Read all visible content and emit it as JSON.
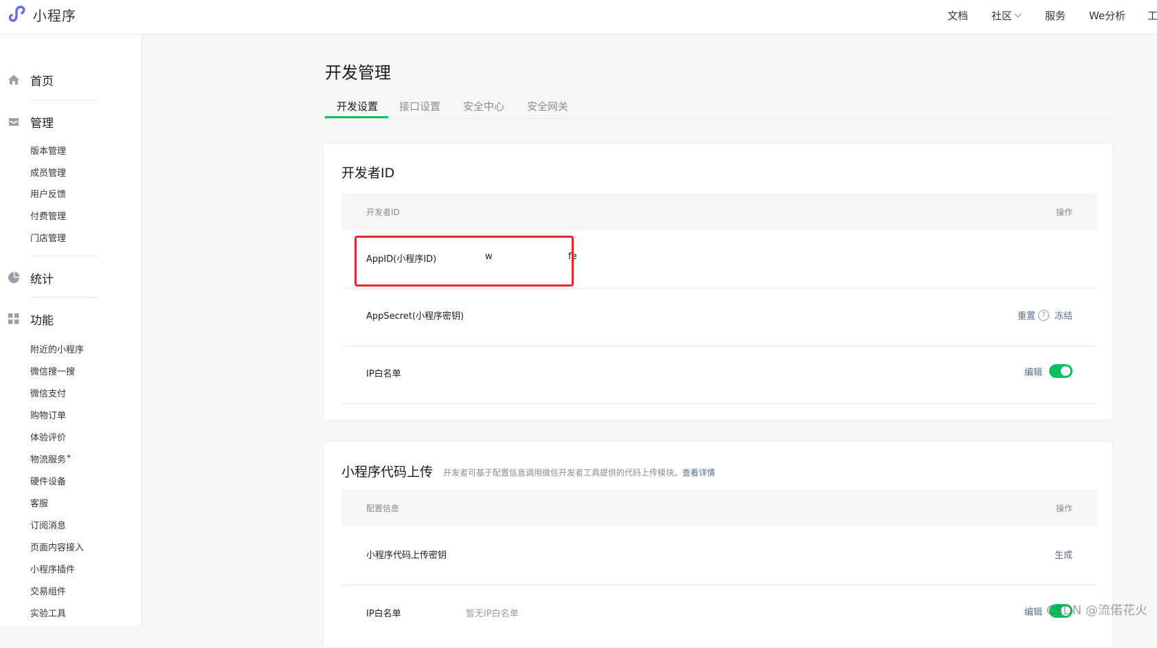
{
  "app": {
    "name": "小程序"
  },
  "topnav": [
    {
      "label": "文档"
    },
    {
      "label": "社区"
    },
    {
      "label": "服务"
    },
    {
      "label": "We分析"
    },
    {
      "label": "工"
    }
  ],
  "sidebar": {
    "home": "首页",
    "manage": {
      "title": "管理",
      "items": [
        "版本管理",
        "成员管理",
        "用户反馈",
        "付费管理",
        "门店管理"
      ]
    },
    "stats": "统计",
    "features": {
      "title": "功能",
      "items": [
        "附近的小程序",
        "微信搜一搜",
        "微信支付",
        "购物订单",
        "体验评价",
        "物流服务",
        "硬件设备",
        "客服",
        "订阅消息",
        "页面内容接入",
        "小程序插件",
        "交易组件",
        "实验工具"
      ]
    }
  },
  "page": {
    "title": "开发管理",
    "tabs": [
      "开发设置",
      "接口设置",
      "安全中心",
      "安全网关"
    ],
    "active_tab": 0
  },
  "dev_id_card": {
    "title": "开发者ID",
    "col_name": "开发者ID",
    "col_ops": "操作",
    "rows": {
      "appid": {
        "label": "AppID(小程序ID)",
        "value_start": "w",
        "value_end": "fe"
      },
      "secret": {
        "label": "AppSecret(小程序密钥)",
        "reset": "重置",
        "help": "?",
        "freeze": "冻结"
      },
      "ip": {
        "label": "IP白名单",
        "edit": "编辑",
        "toggle_on": true
      }
    }
  },
  "upload_card": {
    "title": "小程序代码上传",
    "desc": "开发者可基于配置信息调用微信开发者工具提供的代码上传模块。",
    "desc_link": "查看详情",
    "col_name": "配置信息",
    "col_ops": "操作",
    "rows": {
      "key": {
        "label": "小程序代码上传密钥",
        "action": "生成"
      },
      "ip": {
        "label": "IP白名单",
        "value": "暂无IP白名单",
        "edit": "编辑",
        "toggle_on": true
      }
    }
  },
  "watermark": "CSDN @流偌花火",
  "colors": {
    "accent": "#07c160",
    "link": "#576b95",
    "highlight": "#e2262d"
  }
}
